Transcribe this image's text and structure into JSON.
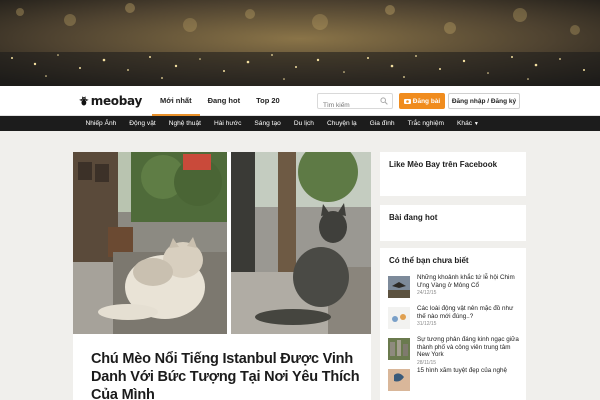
{
  "header": {
    "logo_text": "meobay",
    "tabs": [
      {
        "label": "Mới nhất",
        "active": true
      },
      {
        "label": "Đang hot",
        "active": false
      },
      {
        "label": "Top 20",
        "active": false
      }
    ],
    "search_placeholder": "Tìm kiếm",
    "post_button": "Đăng bài",
    "login_button": "Đăng nhập / Đăng ký",
    "accent_color": "#f08c1e"
  },
  "categories": [
    "Nhiếp Ảnh",
    "Động vật",
    "Nghệ thuật",
    "Hài hước",
    "Sáng tạo",
    "Du lịch",
    "Chuyện lạ",
    "Gia đình",
    "Trắc nghiệm",
    "Khác"
  ],
  "article": {
    "title": "Chú Mèo Nổi Tiếng Istanbul Được Vinh Danh Với Bức Tượng Tại Nơi Yêu Thích Của Mình"
  },
  "sidebar": {
    "facebook_title": "Like Mèo Bay trên Facebook",
    "hot_title": "Bài đang hot",
    "did_you_know_title": "Có thể bạn chưa biết",
    "items": [
      {
        "title": "Những khoảnh khắc tứ lễ hội Chim Ưng Vàng ở Mông Cổ",
        "date": "24/12/15",
        "icon": "eagle-photo"
      },
      {
        "title": "Các loài động vật nên mặc đồ như thế nào mới đúng..?",
        "date": "31/12/15",
        "icon": "animal-illustration"
      },
      {
        "title": "Sự tương phản đáng kinh ngạc giữa thành phố và công viên trung tâm New York",
        "date": "28/11/15",
        "icon": "city-park-photo"
      },
      {
        "title": "15 hình xăm tuyệt đẹp của nghệ",
        "date": "",
        "icon": "tattoo-photo"
      }
    ]
  }
}
